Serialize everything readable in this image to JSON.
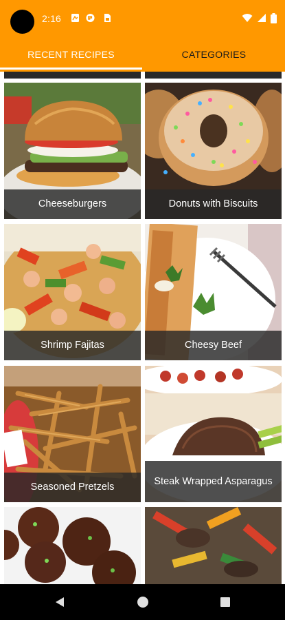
{
  "status_bar": {
    "time": "2:16",
    "icons": [
      "avatar-icon",
      "notification-icon",
      "cast-icon",
      "sim-icon",
      "wifi-icon",
      "signal-icon",
      "battery-icon"
    ]
  },
  "tabs": [
    {
      "label": "RECENT RECIPES",
      "selected": true
    },
    {
      "label": "CATEGORIES",
      "selected": false
    }
  ],
  "colors": {
    "accent": "#ff9800",
    "tab_active_text": "#ffffff",
    "tab_inactive_text": "#1a1a1a",
    "card_label_bg": "#282828"
  },
  "recipes": [
    {
      "title": "Cheeseburgers",
      "image": "cheeseburger-photo"
    },
    {
      "title": "Donuts with Biscuits",
      "image": "donut-photo"
    },
    {
      "title": "Shrimp Fajitas",
      "image": "shrimp-fajitas-photo"
    },
    {
      "title": "Cheesy Beef",
      "image": "cheesy-beef-photo"
    },
    {
      "title": "Seasoned Pretzels",
      "image": "pretzels-photo"
    },
    {
      "title": "Steak Wrapped Asparagus",
      "image": "steak-asparagus-photo"
    },
    {
      "title": "",
      "image": "meatballs-photo"
    },
    {
      "title": "",
      "image": "pepper-steak-photo"
    }
  ],
  "nav": [
    "back-icon",
    "home-icon",
    "recents-icon"
  ]
}
